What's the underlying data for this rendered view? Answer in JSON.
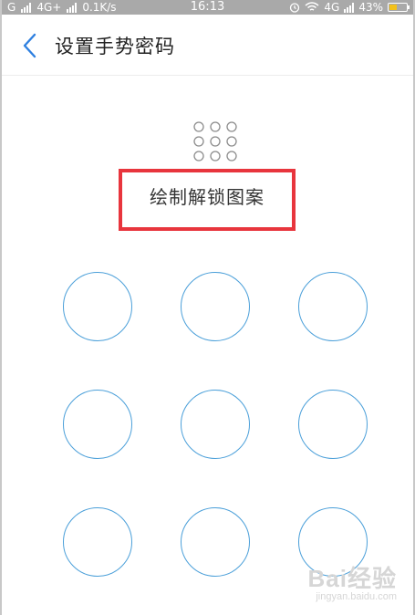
{
  "status_bar": {
    "carrier1": "G",
    "carrier2": "4G+",
    "net_speed": "0.1K/s",
    "time": "16:13",
    "network_right": "4G",
    "battery_percent": "43%",
    "battery_level": 0.43
  },
  "header": {
    "title": "设置手势密码"
  },
  "pattern": {
    "instruction": "绘制解锁图案",
    "rows": 3,
    "cols": 3
  },
  "watermark": {
    "main": "Bai经验",
    "sub": "jingyan.baidu.com"
  },
  "colors": {
    "accent": "#4a9fd9",
    "back_arrow": "#2f80e0",
    "highlight_border": "#e8353d",
    "battery_fill": "#f3c11a"
  }
}
